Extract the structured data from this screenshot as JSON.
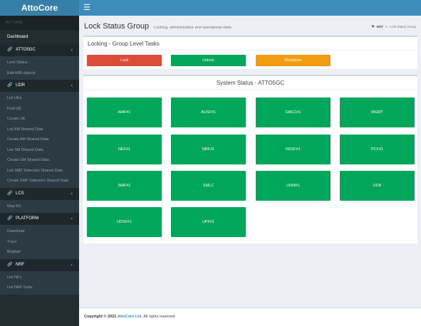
{
  "app": {
    "logo": "AttoCore"
  },
  "sidebar": {
    "header": "ACTIONS",
    "dashboard": "Dashboard",
    "groups": [
      {
        "label": "ATTO5GC",
        "icon": "link-icon",
        "items": [
          "Lock Status",
          "Edit MIB objects"
        ]
      },
      {
        "label": "UDR",
        "icon": "link-icon",
        "items": [
          "List UEs",
          "Find UE",
          "Create UE",
          "List AM Shared Data",
          "Create AM Shared Data",
          "List SM Shared Data",
          "Create SM Shared Data",
          "List SMF Selection Shared Data",
          "Create SMF Selection Shared Data"
        ]
      },
      {
        "label": "LCS",
        "icon": "link-icon",
        "items": [
          "Map 5G"
        ]
      },
      {
        "label": "PLATFORM",
        "icon": "link-icon",
        "items": [
          "Download",
          "Trace",
          "Bugtool"
        ]
      },
      {
        "label": "NRF",
        "icon": "link-icon",
        "items": [
          "List NFs",
          "List NRF Subs"
        ]
      }
    ]
  },
  "header": {
    "title": "Lock Status Group",
    "subtitle": "Locking, administrative and operational state",
    "breadcrumb": {
      "home": "NOT",
      "current": "Lock Status Group"
    }
  },
  "group_tasks": {
    "title": "Locking - Group Level Tasks",
    "lock": "Lock",
    "unlock": "Unlock",
    "shutdown": "Shutdown"
  },
  "system_status": {
    "title": "System Status - ATTO5GC",
    "tiles": [
      "AMF#1",
      "AUSF#1",
      "GMLC#1",
      "MGMT",
      "NEF#1",
      "NRF#1",
      "NSSF#1",
      "PCF#1",
      "SMF#1",
      "SMLC",
      "UDM#1",
      "UDR",
      "UDSF#1",
      "UPF#1"
    ]
  },
  "footer": {
    "copyright": "Copyright © 2021",
    "company": "AttoCore Ltd.",
    "rights": "All rights reserved."
  },
  "colors": {
    "lock": "#dd4b39",
    "unlock": "#00a65a",
    "shutdown": "#f39c12",
    "tile": "#00a65a",
    "header": "#3c8dbc",
    "sidebar": "#222d32"
  }
}
